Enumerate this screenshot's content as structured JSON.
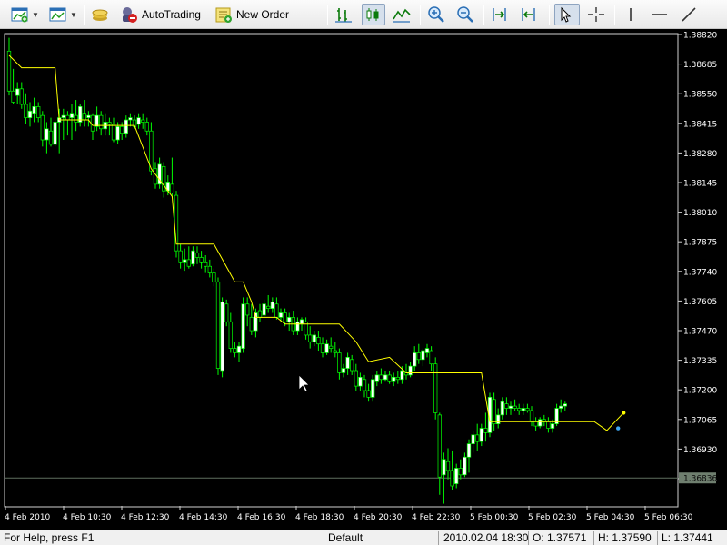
{
  "toolbar": {
    "autotrading_label": "AutoTrading",
    "new_order_label": "New Order",
    "icons": [
      "new-chart-icon",
      "profiles-icon",
      "market-watch-icon",
      "autotrading-icon",
      "new-order-icon",
      "bar-chart-icon",
      "candlestick-chart-icon",
      "line-chart-icon",
      "zoom-in-icon",
      "zoom-out-icon",
      "chart-shift-icon",
      "autoscroll-icon",
      "cursor-icon",
      "crosshair-icon",
      "vertical-line-icon",
      "horizontal-line-icon",
      "trendline-icon"
    ]
  },
  "chart_data": {
    "type": "candlestick",
    "price_scale": [
      "1.38820",
      "1.38685",
      "1.38550",
      "1.38415",
      "1.38280",
      "1.38145",
      "1.38010",
      "1.37875",
      "1.37740",
      "1.37605",
      "1.37470",
      "1.37335",
      "1.37200",
      "1.37065",
      "1.36930",
      "1.36795"
    ],
    "current_price_label": "1.36836",
    "current_price": 1.36836,
    "ylim": [
      1.3671,
      1.38835
    ],
    "time_scale": [
      "4 Feb 2010",
      "4 Feb 10:30",
      "4 Feb 12:30",
      "4 Feb 14:30",
      "4 Feb 16:30",
      "4 Feb 18:30",
      "4 Feb 20:30",
      "4 Feb 22:30",
      "5 Feb 00:30",
      "5 Feb 02:30",
      "5 Feb 04:30",
      "5 Feb 06:30"
    ],
    "colors": {
      "background": "#000000",
      "bull_candle": "#ffffff",
      "bear_candle": "#000000",
      "wick": "#00ff00",
      "indicator": "#ffff00",
      "price_line": "#5f6f5f",
      "axis_text": "#ffffff"
    },
    "indicator_line": [
      [
        0,
        1.38741
      ],
      [
        3,
        1.38685
      ],
      [
        11,
        1.38685
      ],
      [
        12,
        1.3845
      ],
      [
        19,
        1.3845
      ],
      [
        20,
        1.38425
      ],
      [
        30,
        1.38425
      ],
      [
        34,
        1.3823
      ],
      [
        39,
        1.38105
      ],
      [
        40,
        1.3789
      ],
      [
        49,
        1.3789
      ],
      [
        54,
        1.3772
      ],
      [
        56,
        1.3772
      ],
      [
        58,
        1.3763
      ],
      [
        59,
        1.3756
      ],
      [
        64,
        1.3756
      ],
      [
        66,
        1.3753
      ],
      [
        79,
        1.3753
      ],
      [
        83,
        1.3745
      ],
      [
        86,
        1.3736
      ],
      [
        91,
        1.3738
      ],
      [
        95,
        1.3731
      ],
      [
        113,
        1.3731
      ],
      [
        115,
        1.3709
      ],
      [
        140,
        1.3709
      ],
      [
        143,
        1.3705
      ],
      [
        147,
        1.3713
      ]
    ],
    "candles": [
      [
        1.3876,
        1.3882,
        1.3856,
        1.3858
      ],
      [
        1.3858,
        1.3868,
        1.3852,
        1.3853
      ],
      [
        1.3856,
        1.3862,
        1.3852,
        1.3859
      ],
      [
        1.3859,
        1.3862,
        1.385,
        1.3852
      ],
      [
        1.3852,
        1.3857,
        1.3843,
        1.3846
      ],
      [
        1.3846,
        1.3853,
        1.3842,
        1.3849
      ],
      [
        1.3848,
        1.3855,
        1.3844,
        1.3851
      ],
      [
        1.3851,
        1.3853,
        1.3844,
        1.3846
      ],
      [
        1.3847,
        1.3849,
        1.3833,
        1.3836
      ],
      [
        1.3836,
        1.3844,
        1.383,
        1.3841
      ],
      [
        1.384,
        1.3846,
        1.3833,
        1.3834
      ],
      [
        1.3834,
        1.3845,
        1.3833,
        1.3844
      ],
      [
        1.3844,
        1.385,
        1.383,
        1.3846
      ],
      [
        1.3846,
        1.385,
        1.3836,
        1.3847
      ],
      [
        1.3847,
        1.3849,
        1.3838,
        1.3845
      ],
      [
        1.3846,
        1.3852,
        1.3836,
        1.3848
      ],
      [
        1.3847,
        1.3854,
        1.384,
        1.3844
      ],
      [
        1.3844,
        1.3852,
        1.3842,
        1.3851
      ],
      [
        1.3848,
        1.3854,
        1.3842,
        1.3845
      ],
      [
        1.3846,
        1.3849,
        1.3842,
        1.3847
      ],
      [
        1.3847,
        1.3848,
        1.3836,
        1.384
      ],
      [
        1.3842,
        1.3851,
        1.384,
        1.3847
      ],
      [
        1.3847,
        1.3849,
        1.3838,
        1.3841
      ],
      [
        1.3841,
        1.3848,
        1.3838,
        1.3844
      ],
      [
        1.3844,
        1.3846,
        1.3838,
        1.3843
      ],
      [
        1.3843,
        1.3846,
        1.3835,
        1.3836
      ],
      [
        1.3836,
        1.3844,
        1.3834,
        1.3842
      ],
      [
        1.3842,
        1.3844,
        1.3836,
        1.3839
      ],
      [
        1.3839,
        1.3847,
        1.3837,
        1.3845
      ],
      [
        1.3845,
        1.3848,
        1.3842,
        1.3846
      ],
      [
        1.3845,
        1.3847,
        1.3841,
        1.3842
      ],
      [
        1.3843,
        1.3848,
        1.3841,
        1.3846
      ],
      [
        1.3845,
        1.3848,
        1.3841,
        1.3844
      ],
      [
        1.3844,
        1.3846,
        1.3838,
        1.384
      ],
      [
        1.384,
        1.3844,
        1.382,
        1.3822
      ],
      [
        1.3823,
        1.3826,
        1.3814,
        1.3816
      ],
      [
        1.3816,
        1.3828,
        1.3814,
        1.3825
      ],
      [
        1.3824,
        1.3826,
        1.381,
        1.3813
      ],
      [
        1.3813,
        1.382,
        1.3811,
        1.3817
      ],
      [
        1.3816,
        1.3828,
        1.381,
        1.3812
      ],
      [
        1.3811,
        1.3813,
        1.3783,
        1.3786
      ],
      [
        1.3786,
        1.3789,
        1.3778,
        1.3781
      ],
      [
        1.3781,
        1.3787,
        1.3777,
        1.3782
      ],
      [
        1.3782,
        1.3788,
        1.3778,
        1.3779
      ],
      [
        1.378,
        1.3788,
        1.3779,
        1.3786
      ],
      [
        1.3785,
        1.3788,
        1.378,
        1.3783
      ],
      [
        1.3783,
        1.3786,
        1.3778,
        1.3781
      ],
      [
        1.3781,
        1.3784,
        1.3776,
        1.3779
      ],
      [
        1.3779,
        1.3782,
        1.3774,
        1.3776
      ],
      [
        1.3776,
        1.3778,
        1.377,
        1.3772
      ],
      [
        1.3772,
        1.3774,
        1.373,
        1.3733
      ],
      [
        1.3732,
        1.3765,
        1.3729,
        1.3763
      ],
      [
        1.3762,
        1.3764,
        1.3752,
        1.3754
      ],
      [
        1.3754,
        1.3758,
        1.374,
        1.3742
      ],
      [
        1.3742,
        1.3745,
        1.3738,
        1.374
      ],
      [
        1.374,
        1.3745,
        1.3736,
        1.3743
      ],
      [
        1.3742,
        1.3765,
        1.374,
        1.3762
      ],
      [
        1.3762,
        1.3765,
        1.3752,
        1.3757
      ],
      [
        1.3756,
        1.3762,
        1.3748,
        1.375
      ],
      [
        1.375,
        1.376,
        1.3747,
        1.3758
      ],
      [
        1.3759,
        1.3762,
        1.3754,
        1.3756
      ],
      [
        1.3757,
        1.3764,
        1.3756,
        1.3762
      ],
      [
        1.3761,
        1.3766,
        1.3758,
        1.376
      ],
      [
        1.376,
        1.3765,
        1.3758,
        1.3763
      ],
      [
        1.3762,
        1.3765,
        1.3755,
        1.3756
      ],
      [
        1.3756,
        1.376,
        1.3754,
        1.3758
      ],
      [
        1.3758,
        1.376,
        1.3752,
        1.3754
      ],
      [
        1.3754,
        1.3758,
        1.375,
        1.3756
      ],
      [
        1.3756,
        1.3759,
        1.3748,
        1.375
      ],
      [
        1.375,
        1.3756,
        1.3748,
        1.3754
      ],
      [
        1.3753,
        1.3756,
        1.375,
        1.3755
      ],
      [
        1.3754,
        1.3756,
        1.3746,
        1.3748
      ],
      [
        1.3748,
        1.3752,
        1.3742,
        1.3745
      ],
      [
        1.3745,
        1.375,
        1.3743,
        1.3748
      ],
      [
        1.3747,
        1.375,
        1.3741,
        1.3744
      ],
      [
        1.3744,
        1.3747,
        1.3738,
        1.374
      ],
      [
        1.374,
        1.3746,
        1.3739,
        1.3744
      ],
      [
        1.3743,
        1.3747,
        1.374,
        1.3742
      ],
      [
        1.3741,
        1.3745,
        1.3738,
        1.374
      ],
      [
        1.374,
        1.3742,
        1.3728,
        1.3731
      ],
      [
        1.3731,
        1.3735,
        1.3729,
        1.3733
      ],
      [
        1.3733,
        1.374,
        1.373,
        1.3738
      ],
      [
        1.3737,
        1.3739,
        1.373,
        1.3732
      ],
      [
        1.3732,
        1.3735,
        1.3723,
        1.3725
      ],
      [
        1.3725,
        1.3731,
        1.3723,
        1.3729
      ],
      [
        1.3728,
        1.373,
        1.372,
        1.3723
      ],
      [
        1.3723,
        1.3726,
        1.3718,
        1.372
      ],
      [
        1.372,
        1.373,
        1.3718,
        1.3728
      ],
      [
        1.3727,
        1.3732,
        1.3725,
        1.373
      ],
      [
        1.373,
        1.3733,
        1.3726,
        1.3728
      ],
      [
        1.3728,
        1.3732,
        1.3727,
        1.373
      ],
      [
        1.373,
        1.3732,
        1.3726,
        1.3727
      ],
      [
        1.3727,
        1.3731,
        1.3725,
        1.3729
      ],
      [
        1.3729,
        1.3732,
        1.3726,
        1.3728
      ],
      [
        1.3728,
        1.3734,
        1.3726,
        1.3732
      ],
      [
        1.3731,
        1.3735,
        1.3728,
        1.373
      ],
      [
        1.373,
        1.3736,
        1.3729,
        1.3734
      ],
      [
        1.3734,
        1.3743,
        1.3732,
        1.374
      ],
      [
        1.374,
        1.3744,
        1.3735,
        1.3737
      ],
      [
        1.3737,
        1.3742,
        1.3734,
        1.3741
      ],
      [
        1.374,
        1.3744,
        1.3738,
        1.3742
      ],
      [
        1.3741,
        1.3743,
        1.3732,
        1.3735
      ],
      [
        1.3735,
        1.3738,
        1.371,
        1.3713
      ],
      [
        1.3712,
        1.3713,
        1.3676,
        1.3684
      ],
      [
        1.3685,
        1.3695,
        1.3672,
        1.3692
      ],
      [
        1.3691,
        1.3697,
        1.3683,
        1.3687
      ],
      [
        1.3687,
        1.3696,
        1.3678,
        1.368
      ],
      [
        1.3681,
        1.369,
        1.3679,
        1.3688
      ],
      [
        1.3688,
        1.3692,
        1.3683,
        1.3685
      ],
      [
        1.3685,
        1.3695,
        1.3684,
        1.3693
      ],
      [
        1.3693,
        1.3701,
        1.3686,
        1.3699
      ],
      [
        1.3699,
        1.3705,
        1.3695,
        1.3703
      ],
      [
        1.3703,
        1.3708,
        1.3696,
        1.37
      ],
      [
        1.37,
        1.3708,
        1.3698,
        1.3706
      ],
      [
        1.3706,
        1.3713,
        1.37,
        1.3704
      ],
      [
        1.3704,
        1.3722,
        1.3702,
        1.372
      ],
      [
        1.3719,
        1.3722,
        1.3705,
        1.3708
      ],
      [
        1.3708,
        1.3715,
        1.3706,
        1.3712
      ],
      [
        1.3712,
        1.372,
        1.371,
        1.3718
      ],
      [
        1.3717,
        1.372,
        1.3712,
        1.3715
      ],
      [
        1.3715,
        1.3718,
        1.3712,
        1.3716
      ],
      [
        1.3716,
        1.3719,
        1.3714,
        1.3715
      ],
      [
        1.3715,
        1.3717,
        1.3712,
        1.3714
      ],
      [
        1.3714,
        1.3717,
        1.3712,
        1.3715
      ],
      [
        1.3715,
        1.3717,
        1.3713,
        1.3714
      ],
      [
        1.3714,
        1.3716,
        1.3707,
        1.3709
      ],
      [
        1.3709,
        1.3711,
        1.3705,
        1.3707
      ],
      [
        1.3707,
        1.3711,
        1.3706,
        1.371
      ],
      [
        1.371,
        1.3712,
        1.3707,
        1.3709
      ],
      [
        1.3709,
        1.3711,
        1.3704,
        1.3706
      ],
      [
        1.3706,
        1.371,
        1.3704,
        1.3708
      ],
      [
        1.3708,
        1.3717,
        1.3707,
        1.3715
      ],
      [
        1.3715,
        1.3719,
        1.3713,
        1.3716
      ],
      [
        1.3716,
        1.3718,
        1.3714,
        1.3717
      ]
    ]
  },
  "status": {
    "help": "For Help, press F1",
    "profile": "Default",
    "datetime": "2010.02.04 18:30",
    "open": "O: 1.37571",
    "high": "H: 1.37590",
    "low": "L: 1.37441"
  }
}
